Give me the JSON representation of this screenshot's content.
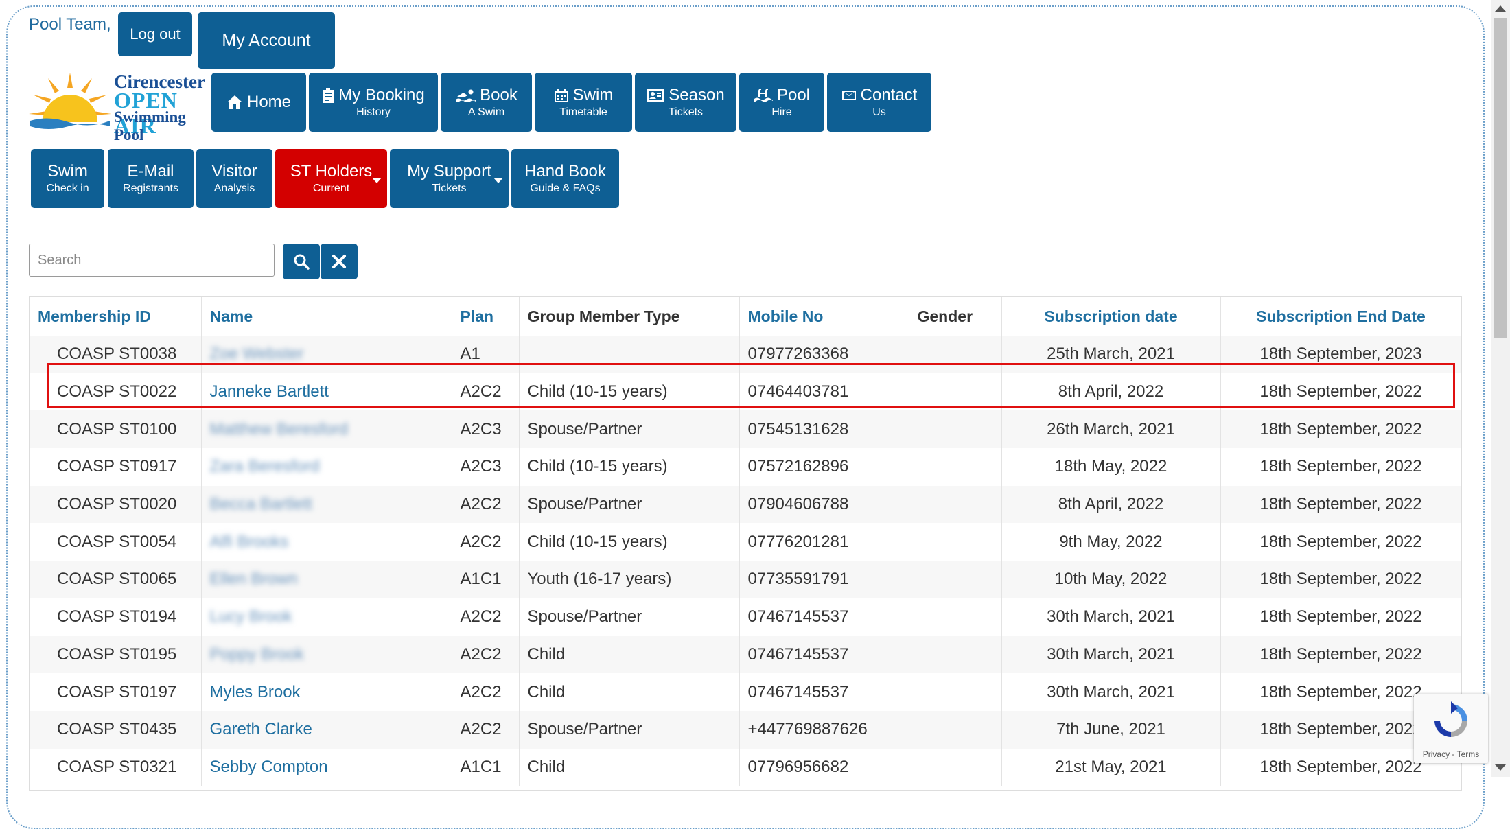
{
  "header": {
    "greeting": "Pool Team,",
    "logout_label": "Log out",
    "my_account_label": "My Account"
  },
  "logo": {
    "line1": "Cirencester",
    "line2": "OPEN AIR",
    "line3": "Swimming Pool"
  },
  "nav": [
    {
      "label": "Home",
      "sub": "",
      "icon": "home-icon"
    },
    {
      "label": "My Booking",
      "sub": "History",
      "icon": "clipboard-icon"
    },
    {
      "label": "Book",
      "sub": "A Swim",
      "icon": "swimmer-icon"
    },
    {
      "label": "Swim",
      "sub": "Timetable",
      "icon": "calendar-icon"
    },
    {
      "label": "Season",
      "sub": "Tickets",
      "icon": "id-card-icon"
    },
    {
      "label": "Pool",
      "sub": "Hire",
      "icon": "pool-ladder-icon"
    },
    {
      "label": "Contact",
      "sub": "Us",
      "icon": "envelope-icon"
    }
  ],
  "subnav": [
    {
      "label": "Swim",
      "sub": "Check in"
    },
    {
      "label": "E-Mail",
      "sub": "Registrants"
    },
    {
      "label": "Visitor",
      "sub": "Analysis"
    },
    {
      "label": "ST Holders",
      "sub": "Current"
    },
    {
      "label": "My Support",
      "sub": "Tickets"
    },
    {
      "label": "Hand Book",
      "sub": "Guide & FAQs"
    }
  ],
  "search": {
    "placeholder": "Search"
  },
  "table": {
    "headers": [
      "Membership ID",
      "Name",
      "Plan",
      "Group Member Type",
      "Mobile No",
      "Gender",
      "Subscription date",
      "Subscription End Date"
    ],
    "rows": [
      [
        "COASP ST0038",
        "Zoe Webster",
        "A1",
        "",
        "07977263368",
        "",
        "25th March, 2021",
        "18th September, 2023"
      ],
      [
        "COASP ST0022",
        "Janneke Bartlett",
        "A2C2",
        "Child (10-15 years)",
        "07464403781",
        "",
        "8th April, 2022",
        "18th September, 2022"
      ],
      [
        "COASP ST0100",
        "Matthew Beresford",
        "A2C3",
        "Spouse/Partner",
        "07545131628",
        "",
        "26th March, 2021",
        "18th September, 2022"
      ],
      [
        "COASP ST0917",
        "Zara Beresford",
        "A2C3",
        "Child (10-15 years)",
        "07572162896",
        "",
        "18th May, 2022",
        "18th September, 2022"
      ],
      [
        "COASP ST0020",
        "Becca Bartlett",
        "A2C2",
        "Spouse/Partner",
        "07904606788",
        "",
        "8th April, 2022",
        "18th September, 2022"
      ],
      [
        "COASP ST0054",
        "Alfi Brooks",
        "A2C2",
        "Child (10-15 years)",
        "07776201281",
        "",
        "9th May, 2022",
        "18th September, 2022"
      ],
      [
        "COASP ST0065",
        "Ellen Brown",
        "A1C1",
        "Youth (16-17 years)",
        "07735591791",
        "",
        "10th May, 2022",
        "18th September, 2022"
      ],
      [
        "COASP ST0194",
        "Lucy Brook",
        "A2C2",
        "Spouse/Partner",
        "07467145537",
        "",
        "30th March, 2021",
        "18th September, 2022"
      ],
      [
        "COASP ST0195",
        "Poppy Brook",
        "A2C2",
        "Child",
        "07467145537",
        "",
        "30th March, 2021",
        "18th September, 2022"
      ],
      [
        "COASP ST0197",
        "Myles Brook",
        "A2C2",
        "Child",
        "07467145537",
        "",
        "30th March, 2021",
        "18th September, 2022"
      ],
      [
        "COASP ST0435",
        "Gareth Clarke",
        "A2C2",
        "Spouse/Partner",
        "+447769887626",
        "",
        "7th June, 2021",
        "18th September, 2022"
      ],
      [
        "COASP ST0321",
        "Sebby Compton",
        "A1C1",
        "Child",
        "07796956682",
        "",
        "21st May, 2021",
        "18th September, 2022"
      ]
    ]
  },
  "recaptcha": {
    "privacy": "Privacy",
    "sep": " - ",
    "terms": "Terms"
  }
}
